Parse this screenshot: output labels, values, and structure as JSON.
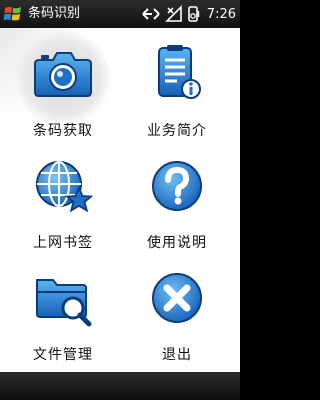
{
  "status_bar": {
    "app_title": "条码识别",
    "time": "7:26",
    "icons": [
      "windows-start-icon",
      "connectivity-icon",
      "signal-icon",
      "speaker-icon"
    ]
  },
  "menu": {
    "tiles": [
      {
        "label": "条码获取",
        "icon": "camera-icon",
        "selected": true
      },
      {
        "label": "业务简介",
        "icon": "info-document-icon",
        "selected": false
      },
      {
        "label": "上网书签",
        "icon": "globe-star-icon",
        "selected": false
      },
      {
        "label": "使用说明",
        "icon": "help-icon",
        "selected": false
      },
      {
        "label": "文件管理",
        "icon": "folder-search-icon",
        "selected": false
      },
      {
        "label": "退出",
        "icon": "exit-icon",
        "selected": false
      }
    ]
  },
  "colors": {
    "icon_blue": "#1e6fc8",
    "icon_blue_light": "#4aa3ec",
    "icon_outline": "#0a3d7a",
    "bar_dark": "#1a1a1a"
  }
}
